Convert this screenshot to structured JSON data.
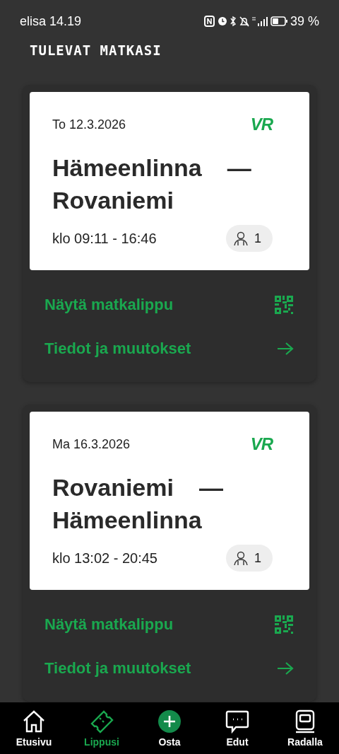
{
  "status_bar": {
    "carrier": "elisa",
    "time": "14.19",
    "battery": "39 %"
  },
  "heading": "TULEVAT MATKASI",
  "trips": [
    {
      "date": "To 12.3.2026",
      "logo": "VR",
      "from": "Hämeenlinna",
      "separator": "—",
      "to": "Rovaniemi",
      "time": "klo 09:11 - 16:46",
      "passengers": "1",
      "actions": [
        {
          "kind": "qr",
          "label": "Näytä matkalippu"
        },
        {
          "kind": "arrow",
          "label": "Tiedot ja muutokset"
        }
      ]
    },
    {
      "date": "Ma 16.3.2026",
      "logo": "VR",
      "from": "Rovaniemi",
      "separator": "—",
      "to": "Hämeenlinna",
      "time": "klo 13:02 - 20:45",
      "passengers": "1",
      "actions": [
        {
          "kind": "qr",
          "label": "Näytä matkalippu"
        },
        {
          "kind": "arrow",
          "label": "Tiedot ja muutokset"
        }
      ]
    }
  ],
  "nav": [
    {
      "kind": "home",
      "label": "Etusivu",
      "selected": false
    },
    {
      "kind": "ticket",
      "label": "Lippusi",
      "selected": true
    },
    {
      "kind": "buy",
      "label": "Osta",
      "selected": false
    },
    {
      "kind": "chat",
      "label": "Edut",
      "selected": false
    },
    {
      "kind": "train",
      "label": "Radalla",
      "selected": false
    }
  ]
}
